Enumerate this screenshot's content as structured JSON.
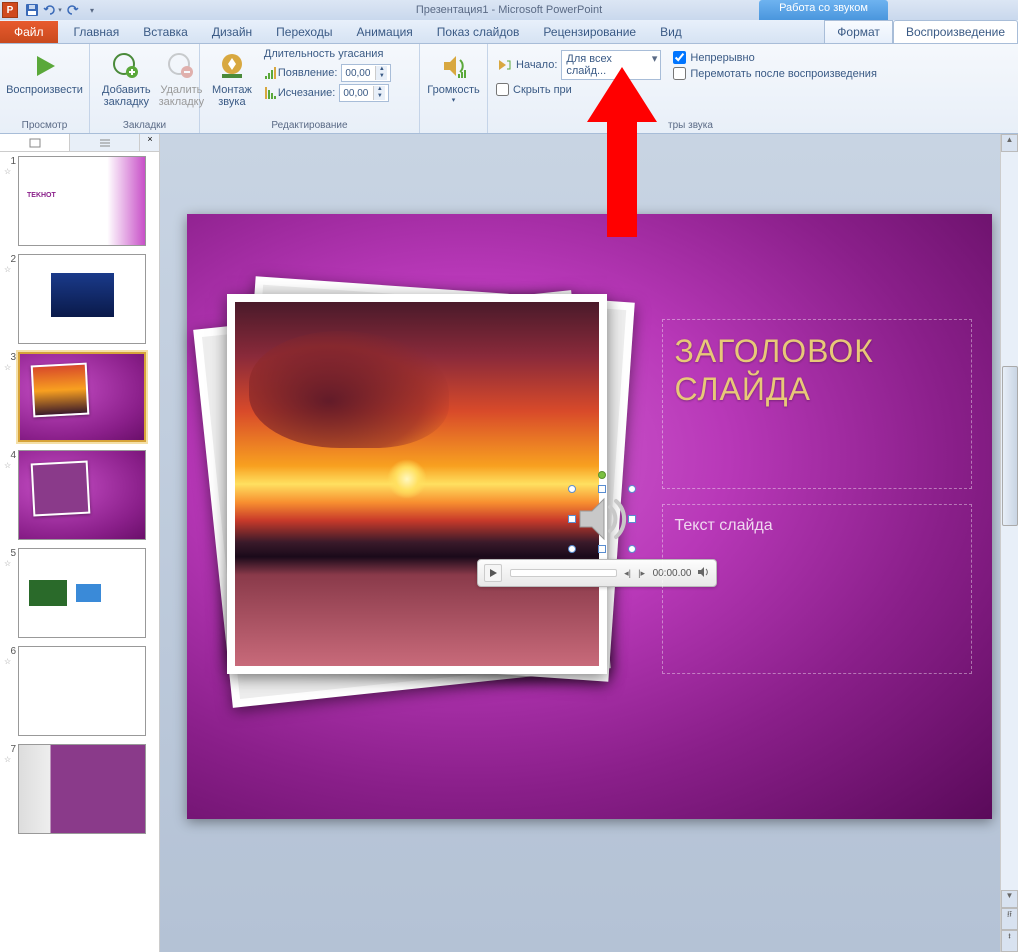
{
  "title": "Презентация1 - Microsoft PowerPoint",
  "contextual_title": "Работа со звуком",
  "file_tab": "Файл",
  "tabs": {
    "home": "Главная",
    "insert": "Вставка",
    "design": "Дизайн",
    "transitions": "Переходы",
    "animations": "Анимация",
    "slideshow": "Показ слайдов",
    "review": "Рецензирование",
    "view": "Вид",
    "format": "Формат",
    "playback": "Воспроизведение"
  },
  "ribbon": {
    "preview": {
      "play": "Воспроизвести",
      "group": "Просмотр"
    },
    "bookmarks": {
      "add": "Добавить",
      "add2": "закладку",
      "remove": "Удалить",
      "remove2": "закладку",
      "group": "Закладки"
    },
    "editing": {
      "trim": "Монтаж",
      "trim2": "звука",
      "fade_title": "Длительность угасания",
      "fade_in": "Появление:",
      "fade_out": "Исчезание:",
      "fade_in_val": "00,00",
      "fade_out_val": "00,00",
      "group": "Редактирование"
    },
    "options": {
      "volume": "Громкость",
      "start_label": "Начало:",
      "start_value": "Для всех слайд...",
      "hide": "Скрыть при",
      "loop": "Непрерывно",
      "rewind": "Перемотать после воспроизведения",
      "group": "тры звука"
    }
  },
  "panel": {
    "close": "×"
  },
  "thumbs": [
    {
      "n": "1"
    },
    {
      "n": "2"
    },
    {
      "n": "3"
    },
    {
      "n": "4"
    },
    {
      "n": "5"
    },
    {
      "n": "6"
    },
    {
      "n": "7"
    }
  ],
  "slide": {
    "title": "ЗАГОЛОВОК СЛАЙДА",
    "subtitle": "Текст слайда",
    "audio_time": "00:00.00"
  }
}
